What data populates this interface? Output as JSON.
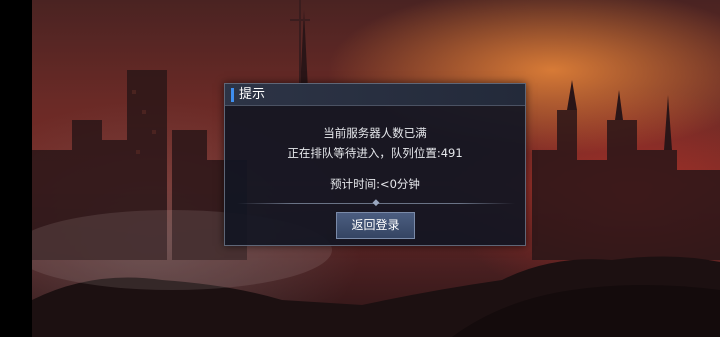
{
  "dialog": {
    "title": "提示",
    "message_line1": "当前服务器人数已满",
    "message_line2": "正在排队等待进入，队列位置:491",
    "message_line3": "预计时间:<0分钟",
    "back_button_label": "返回登录"
  },
  "colors": {
    "accent": "#3f8ff0",
    "dialog_bg": "#121622",
    "button_bg": "#44557a"
  }
}
